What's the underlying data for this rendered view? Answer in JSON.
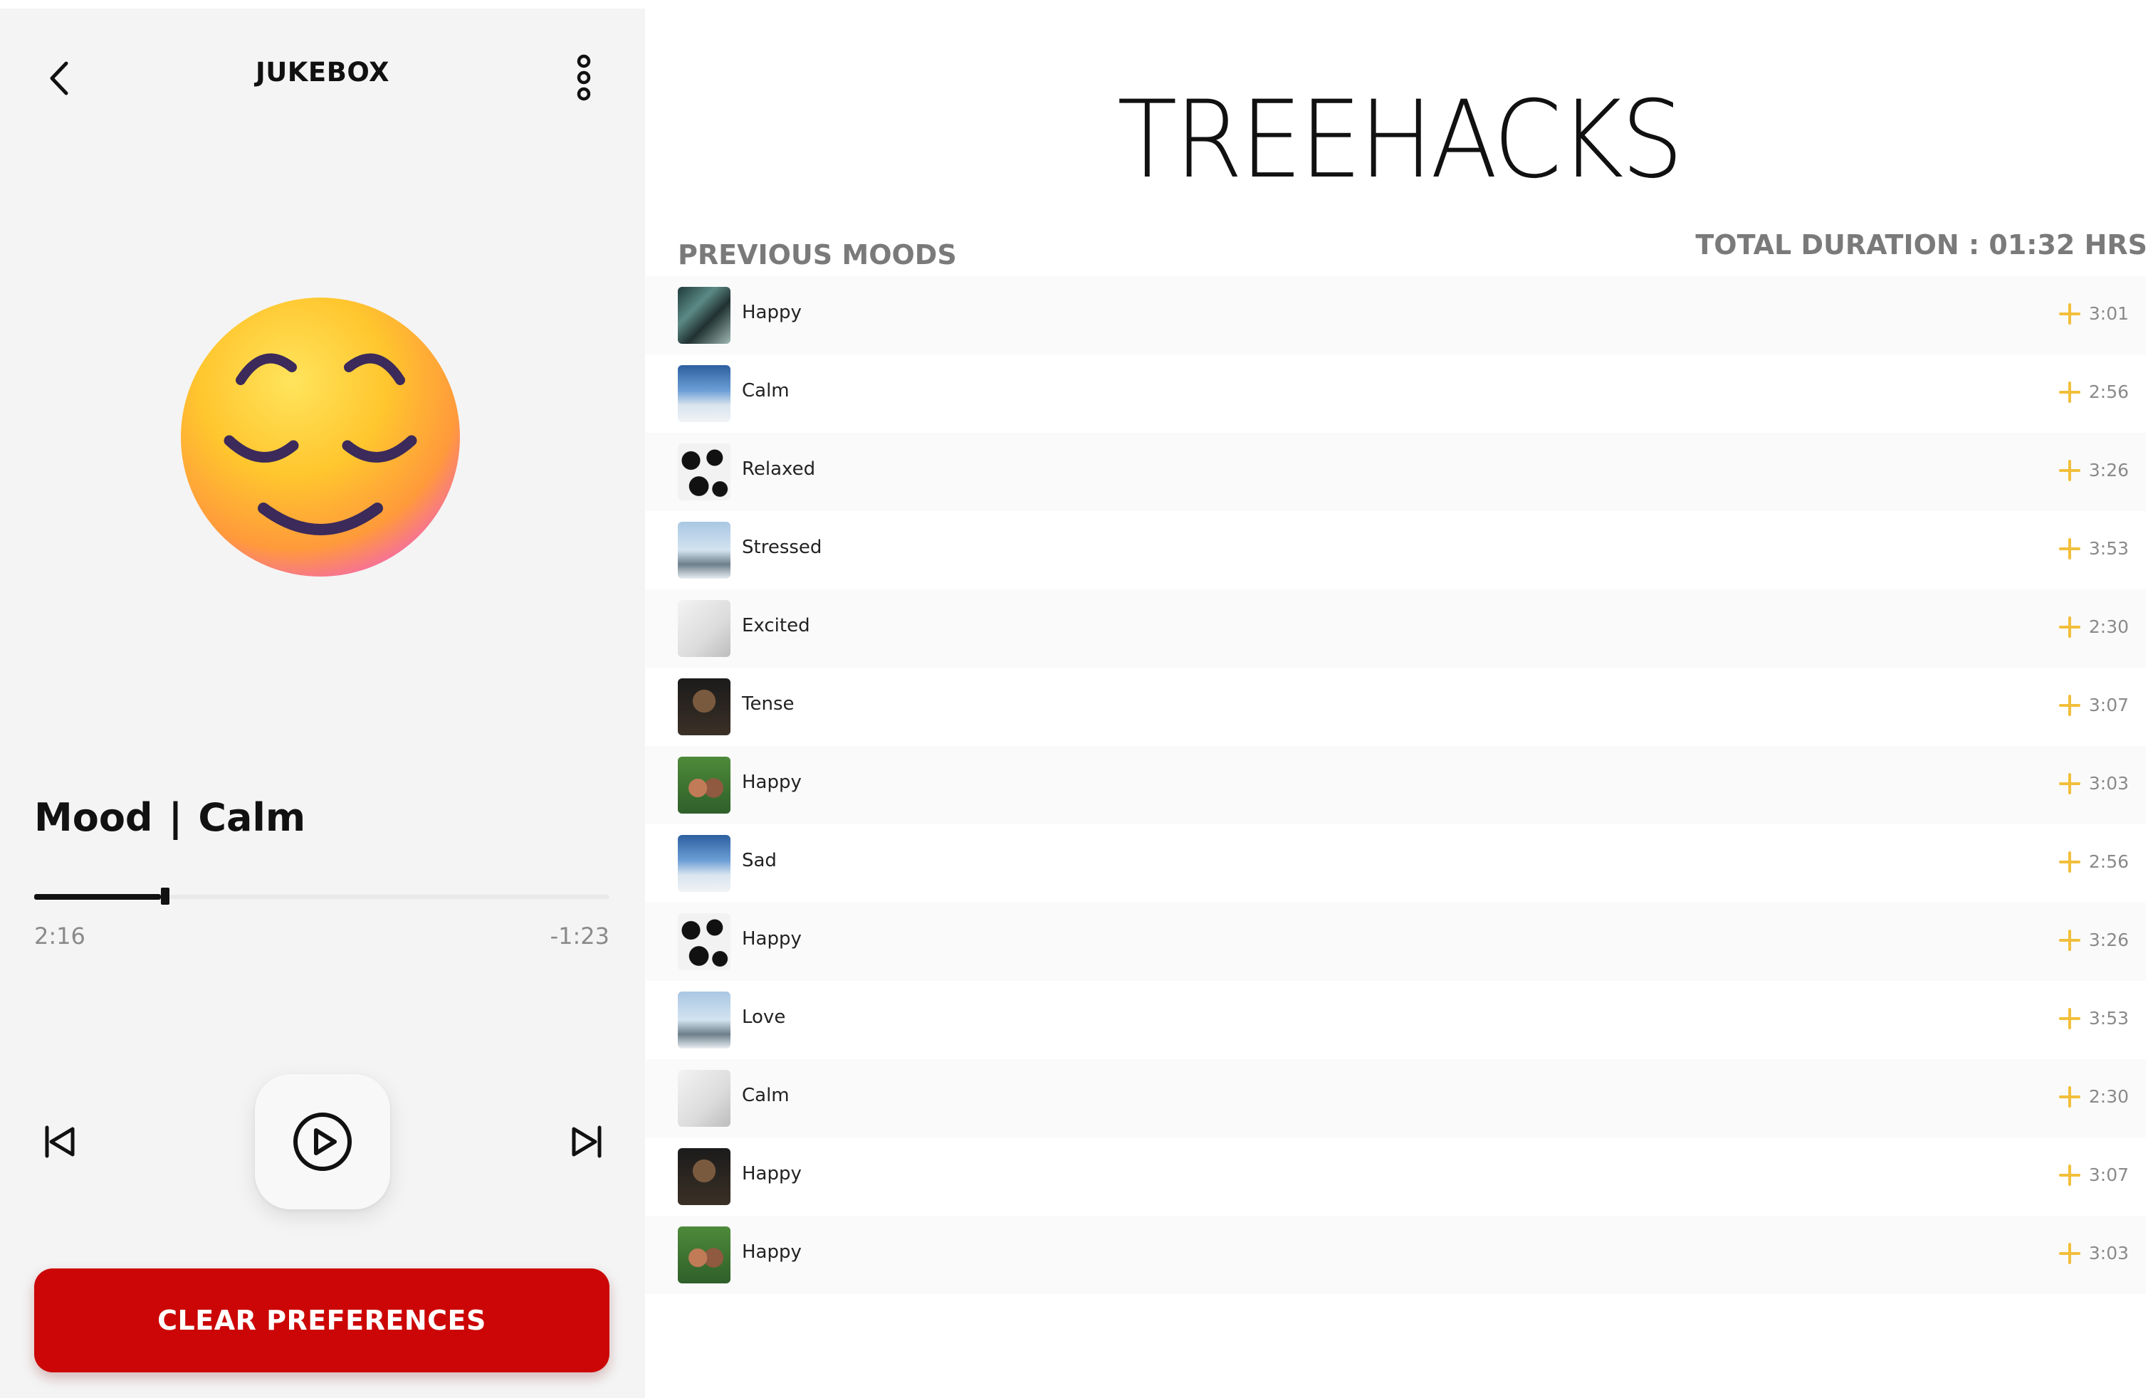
{
  "header": {
    "title": "JUKEBOX"
  },
  "player": {
    "mood_label": "Mood",
    "mood_separator": "|",
    "mood_value": "Calm",
    "progress": 0.22,
    "time_elapsed": "2:16",
    "time_remaining": "-1:23",
    "clear_button_label": "CLEAR PREFERENCES"
  },
  "brand": {
    "title": "TREEHACKS"
  },
  "moods": {
    "section_title": "PREVIOUS MOODS",
    "total_duration": "TOTAL DURATION : 01:32 HRS",
    "items": [
      {
        "label": "Happy",
        "duration": "3:01",
        "art": "t-a"
      },
      {
        "label": "Calm",
        "duration": "2:56",
        "art": "t-b"
      },
      {
        "label": "Relaxed",
        "duration": "3:26",
        "art": "t-c"
      },
      {
        "label": "Stressed",
        "duration": "3:53",
        "art": "t-d"
      },
      {
        "label": "Excited",
        "duration": "2:30",
        "art": "t-e"
      },
      {
        "label": "Tense",
        "duration": "3:07",
        "art": "t-f"
      },
      {
        "label": "Happy",
        "duration": "3:03",
        "art": "t-g"
      },
      {
        "label": "Sad",
        "duration": "2:56",
        "art": "t-b"
      },
      {
        "label": "Happy",
        "duration": "3:26",
        "art": "t-c"
      },
      {
        "label": "Love",
        "duration": "3:53",
        "art": "t-d"
      },
      {
        "label": "Calm",
        "duration": "2:30",
        "art": "t-e"
      },
      {
        "label": "Happy",
        "duration": "3:07",
        "art": "t-f"
      },
      {
        "label": "Happy",
        "duration": "3:03",
        "art": "t-g"
      }
    ]
  },
  "colors": {
    "accent_red": "#cc0606",
    "add_icon": "#f2bf3b"
  }
}
